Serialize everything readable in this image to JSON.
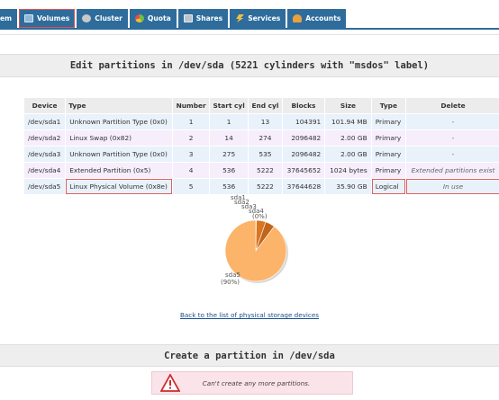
{
  "nav": {
    "tabs": [
      {
        "label": "em",
        "icon": "partial-tab"
      },
      {
        "label": "Volumes",
        "icon": "volumes-icon"
      },
      {
        "label": "Cluster",
        "icon": "cluster-icon"
      },
      {
        "label": "Quota",
        "icon": "quota-icon"
      },
      {
        "label": "Shares",
        "icon": "shares-icon"
      },
      {
        "label": "Services",
        "icon": "services-icon"
      },
      {
        "label": "Accounts",
        "icon": "accounts-icon"
      }
    ],
    "accent": "#2e6c9c",
    "active_tab": "Volumes"
  },
  "edit_section": {
    "title": "Edit partitions in /dev/sda (5221 cylinders with \"msdos\" label)"
  },
  "table": {
    "headers": [
      "Device",
      "Type",
      "Number",
      "Start cyl",
      "End cyl",
      "Blocks",
      "Size",
      "Type",
      "Delete"
    ],
    "rows": [
      {
        "device": "/dev/sda1",
        "type": "Unknown Partition Type (0x0)",
        "number": "1",
        "start": "1",
        "end": "13",
        "blocks": "104391",
        "size": "101.94 MB",
        "ptype": "Primary",
        "delete": "-"
      },
      {
        "device": "/dev/sda2",
        "type": "Linux Swap (0x82)",
        "number": "2",
        "start": "14",
        "end": "274",
        "blocks": "2096482",
        "size": "2.00 GB",
        "ptype": "Primary",
        "delete": "-"
      },
      {
        "device": "/dev/sda3",
        "type": "Unknown Partition Type (0x0)",
        "number": "3",
        "start": "275",
        "end": "535",
        "blocks": "2096482",
        "size": "2.00 GB",
        "ptype": "Primary",
        "delete": "-"
      },
      {
        "device": "/dev/sda4",
        "type": "Extended Partition (0x5)",
        "number": "4",
        "start": "536",
        "end": "5222",
        "blocks": "37645652",
        "size": "1024 bytes",
        "ptype": "Primary",
        "delete": "Extended partitions exist"
      },
      {
        "device": "/dev/sda5",
        "type": "Linux Physical Volume (0x8e)",
        "number": "5",
        "start": "536",
        "end": "5222",
        "blocks": "37644628",
        "size": "35.90 GB",
        "ptype": "Logical",
        "delete": "In use"
      }
    ]
  },
  "chart_data": {
    "type": "pie",
    "slices": [
      {
        "label": "sda1",
        "value": 0.3
      },
      {
        "label": "sda2",
        "value": 5
      },
      {
        "label": "sda3",
        "value": 5
      },
      {
        "label": "sda4",
        "value": 0.0
      },
      {
        "label": "sda5",
        "value": 90
      }
    ],
    "annotations": {
      "sda1_label": "sda1",
      "sda2_label": "sda2",
      "sda3_label": "sda3",
      "sda4_label": "sda4",
      "sda4_pct": "(0%)",
      "sda5_label": "sda5",
      "sda5_pct": "(90%)"
    },
    "colors": {
      "main": "#fbb469",
      "small": "#c0651a"
    }
  },
  "back_link": "Back to the list of physical storage devices",
  "create_section": {
    "title": "Create a partition in /dev/sda",
    "error": "Can't create any more partitions."
  }
}
